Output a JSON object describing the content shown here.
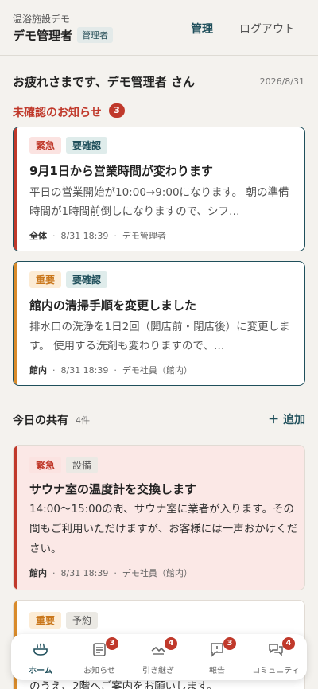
{
  "header": {
    "facility": "温浴施設デモ",
    "admin_name": "デモ管理者",
    "role": "管理者",
    "nav_manage": "管理",
    "nav_logout": "ログアウト"
  },
  "greeting": "お疲れさまです、デモ管理者 さん",
  "date": "2026/8/31",
  "unread": {
    "title": "未確認のお知らせ",
    "count": "3"
  },
  "notices": [
    {
      "tags": [
        "緊急",
        "要確認"
      ],
      "title": "9月1日から営業時間が変わります",
      "body": "平日の営業開始が10:00→9:00になります。 朝の準備時間が1時間前倒しになりますので、シフ…",
      "scope": "全体",
      "time": "8/31 18:39",
      "author": "デモ管理者"
    },
    {
      "tags": [
        "重要",
        "要確認"
      ],
      "title": "館内の清掃手順を変更しました",
      "body": "排水口の洗浄を1日2回（開店前・閉店後）に変更します。 使用する洗剤も変わりますので、…",
      "scope": "館内",
      "time": "8/31 18:39",
      "author": "デモ社員（館内）"
    }
  ],
  "today": {
    "title": "今日の共有",
    "count": "4件",
    "add": "＋ 追加"
  },
  "shares": [
    {
      "tags": [
        "緊急",
        "設備"
      ],
      "title": "サウナ室の温度計を交換します",
      "body": "14:00〜15:00の間、サウナ室に業者が入ります。その間もご利用いただけますが、お客様には一声おかけください。",
      "scope": "館内",
      "time": "8/31 18:39",
      "author": "デモ社員（館内）"
    },
    {
      "tags": [
        "重要",
        "予約"
      ],
      "body_tail": "のうえ、2階へご案内をお願いします。"
    }
  ],
  "bottom_nav": [
    {
      "label": "ホーム",
      "icon": "bath-icon",
      "badge": ""
    },
    {
      "label": "お知らせ",
      "icon": "notice-icon",
      "badge": "3"
    },
    {
      "label": "引き継ぎ",
      "icon": "handover-icon",
      "badge": "4"
    },
    {
      "label": "報告",
      "icon": "report-icon",
      "badge": "3"
    },
    {
      "label": "コミュニティ",
      "icon": "community-icon",
      "badge": "4"
    }
  ],
  "colors": {
    "urgent": "#c0392b",
    "important": "#d98b2b",
    "accent": "#1f4f5b",
    "urgent_bg": "#fdecea"
  }
}
